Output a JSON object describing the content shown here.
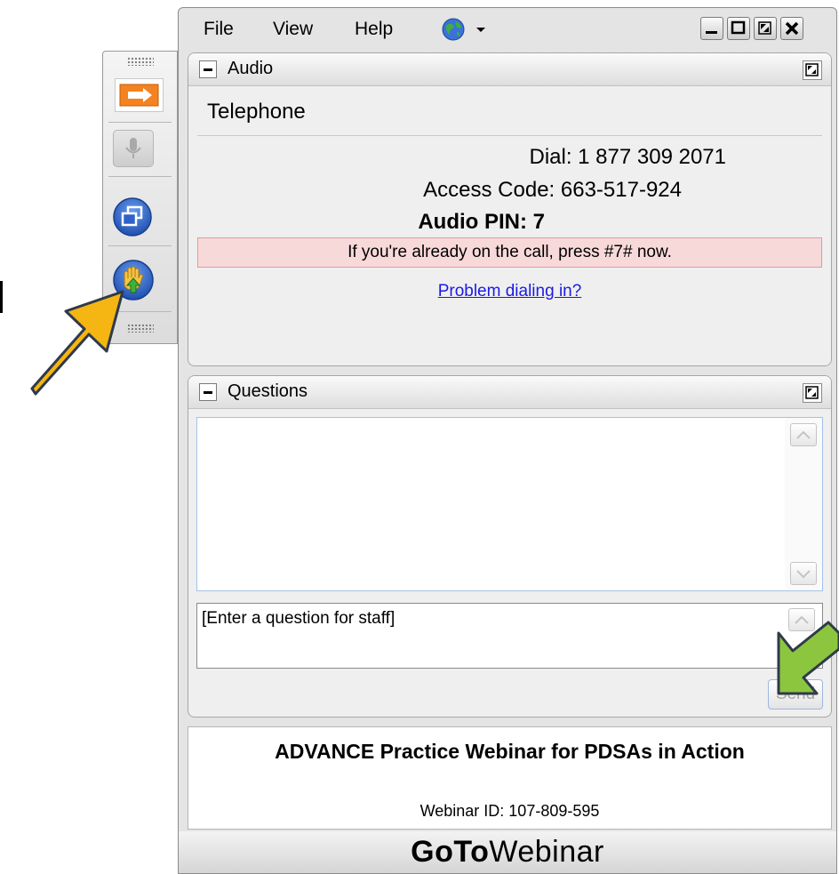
{
  "menubar": {
    "items": [
      "File",
      "View",
      "Help"
    ]
  },
  "audio": {
    "header": "Audio",
    "mode": "Telephone",
    "dial": "Dial: 1 877 309 2071",
    "access_code": "Access Code: 663-517-924",
    "audio_pin": "Audio PIN: 7",
    "notice": "If you're already on the call, press #7# now.",
    "problem_link": "Problem dialing in?"
  },
  "questions": {
    "header": "Questions",
    "input_placeholder": "[Enter a question for staff]",
    "send_label": "Send"
  },
  "webinar": {
    "title": "ADVANCE Practice Webinar for PDSAs in Action",
    "id_line": "Webinar ID: 107-809-595"
  },
  "brand": {
    "go": "Go",
    "to": "To",
    "rest": "Webinar"
  },
  "colors": {
    "orange_arrow": "#F5B512",
    "green_arrow": "#8CC63E",
    "notice_bg": "#F8D9D9",
    "link": "#1A1AE6",
    "button_blue": "#2F62C8"
  },
  "icons": [
    "arrow-right-icon",
    "microphone-icon",
    "window-icon",
    "raise-hand-icon",
    "globe-icon",
    "minimize-icon",
    "maximize-icon",
    "restore-icon",
    "close-icon"
  ]
}
